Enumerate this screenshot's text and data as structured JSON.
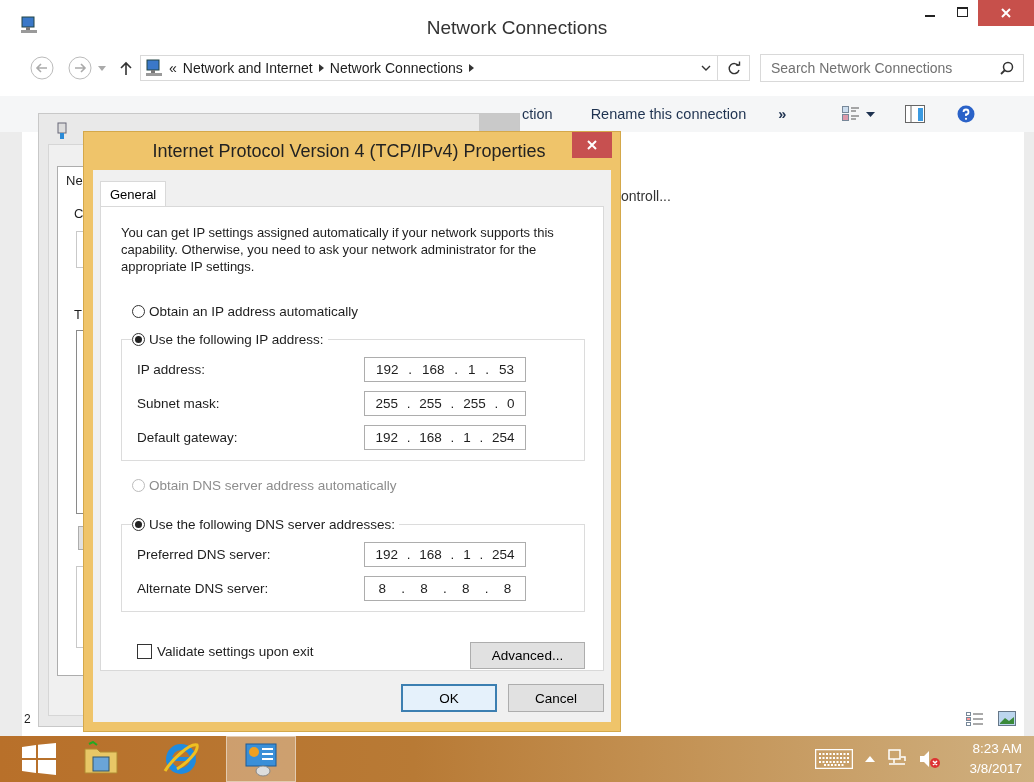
{
  "explorer": {
    "title": "Network Connections",
    "address": {
      "overflow": "«",
      "crumbs": [
        "Network and Internet",
        "Network Connections"
      ]
    },
    "search": {
      "placeholder": "Search Network Connections"
    },
    "toolbar": {
      "items": [
        "ction",
        "Rename this connection"
      ],
      "more": "»"
    },
    "content": {
      "item_text": "ontroll..."
    },
    "status_fragment": "2"
  },
  "behind_dialog": {
    "tab_fragment": "Ne",
    "labels": [
      "C",
      "T"
    ]
  },
  "dialog": {
    "title": "Internet Protocol Version 4 (TCP/IPv4) Properties",
    "tabs": [
      {
        "label": "General",
        "selected": true
      }
    ],
    "intro": "You can get IP settings assigned automatically if your network supports this capability. Otherwise, you need to ask your network administrator for the appropriate IP settings.",
    "ip_mode": [
      {
        "label": "Obtain an IP address automatically",
        "selected": false,
        "disabled": false
      },
      {
        "label": "Use the following IP address:",
        "selected": true,
        "disabled": false
      }
    ],
    "ip_fields": [
      {
        "label": "IP address:",
        "parts": [
          "192",
          ".",
          "168",
          ".",
          "1",
          ".",
          "53"
        ]
      },
      {
        "label": "Subnet mask:",
        "parts": [
          "255",
          ".",
          "255",
          ".",
          "255",
          ".",
          "0"
        ]
      },
      {
        "label": "Default gateway:",
        "parts": [
          "192",
          ".",
          "168",
          ".",
          "1",
          ".",
          "254"
        ]
      }
    ],
    "dns_mode": [
      {
        "label": "Obtain DNS server address automatically",
        "selected": false,
        "disabled": true
      },
      {
        "label": "Use the following DNS server addresses:",
        "selected": true,
        "disabled": false
      }
    ],
    "dns_fields": [
      {
        "label": "Preferred DNS server:",
        "parts": [
          "192",
          ".",
          "168",
          ".",
          "1",
          ".",
          "254"
        ]
      },
      {
        "label": "Alternate DNS server:",
        "parts": [
          "8",
          ".",
          "8",
          ".",
          "8",
          ".",
          "8"
        ]
      }
    ],
    "validate": {
      "label": "Validate settings upon exit",
      "checked": false
    },
    "advanced": "Advanced...",
    "buttons": [
      {
        "label": "OK",
        "default": true
      },
      {
        "label": "Cancel",
        "default": false
      }
    ]
  },
  "taskbar": {
    "apps": [
      {
        "kind": "folder",
        "active": false
      },
      {
        "kind": "browser",
        "active": false
      },
      {
        "kind": "control-panel",
        "active": true
      }
    ],
    "time": "8:23 AM",
    "date": "3/8/2017"
  }
}
